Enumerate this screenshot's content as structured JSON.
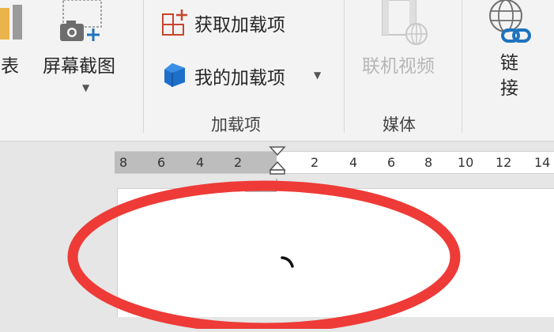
{
  "ribbon": {
    "chart_btn": {
      "label": "图表",
      "icon": "chart-icon"
    },
    "screenshot_btn": {
      "label": "屏幕截图",
      "icon": "screenshot-icon"
    },
    "get_addins": {
      "label": "获取加载项",
      "icon": "store-icon"
    },
    "my_addins": {
      "label": "我的加载项",
      "icon": "addins-cube-icon"
    },
    "online_video": {
      "label": "联机视频",
      "icon": "online-video-icon"
    },
    "link": {
      "label": "链\n接",
      "icon": "link-globe-icon"
    },
    "groups": {
      "addins": "加载项",
      "media": "媒体"
    }
  },
  "ruler": {
    "left_ticks": [
      "8",
      "6",
      "4",
      "2"
    ],
    "right_ticks": [
      "2",
      "4",
      "6",
      "8",
      "10",
      "12",
      "14"
    ]
  },
  "colors": {
    "annotation_red": "#ee3b37",
    "ribbon_bg": "#f3f3f3",
    "ruler_margin": "#bdbdbd"
  }
}
